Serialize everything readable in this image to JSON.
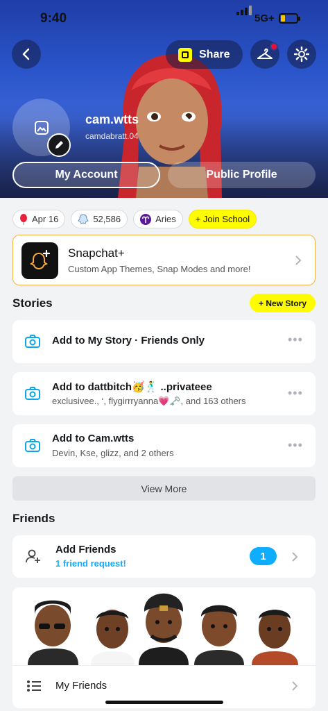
{
  "status_bar": {
    "time": "9:40",
    "network": "5G+"
  },
  "header": {
    "share_label": "Share",
    "display_name": "cam.wtts",
    "username": "camdabratt.04",
    "my_account_label": "My Account",
    "public_profile_label": "Public Profile"
  },
  "chips": {
    "birthday": "Apr 16",
    "score": "52,586",
    "zodiac": "Aries",
    "school": "+ Join School"
  },
  "snapchat_plus": {
    "title": "Snapchat+",
    "subtitle": "Custom App Themes, Snap Modes and more!"
  },
  "stories": {
    "section_title": "Stories",
    "new_story_label": "+ New Story",
    "items": [
      {
        "title": "Add to My Story · Friends Only",
        "subtitle": ""
      },
      {
        "title": "Add to dattbitch🥳🕺 ..privateee",
        "subtitle": "exclusivee., ‘, flygirrryanna💗🗝️, and 163 others"
      },
      {
        "title": "Add to Cam.wtts",
        "subtitle": "Devin, Kse, glizz, and 2 others"
      }
    ],
    "view_more_label": "View More"
  },
  "friends": {
    "section_title": "Friends",
    "add_friends_title": "Add Friends",
    "add_friends_sub": "1 friend request!",
    "request_count": "1",
    "my_friends_label": "My Friends"
  },
  "colors": {
    "accent_yellow": "#fffc00",
    "link_blue": "#0fadff",
    "camera_blue": "#0ea5e9",
    "header_blue": "#2a54c9"
  }
}
